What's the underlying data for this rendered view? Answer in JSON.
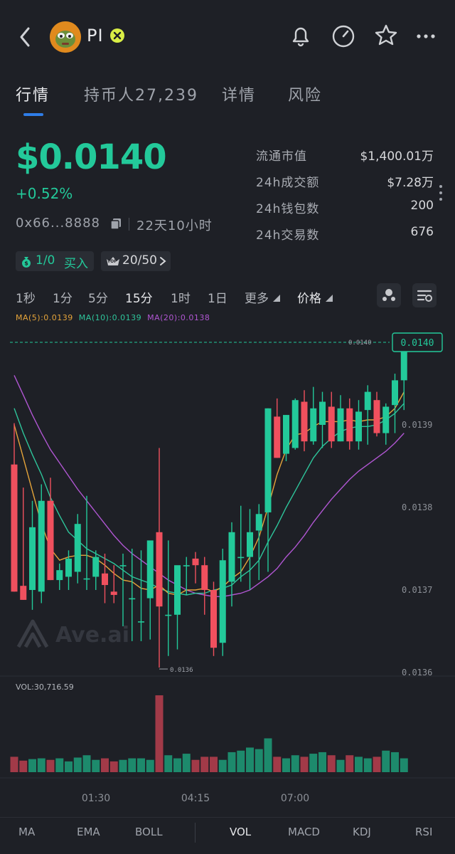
{
  "header": {
    "token_name": "PI",
    "icons": [
      "back-icon",
      "bell-icon",
      "gauge-icon",
      "star-icon",
      "more-icon"
    ]
  },
  "tabs": [
    {
      "label": "行情",
      "active": true
    },
    {
      "label": "持币人27,239",
      "active": false
    },
    {
      "label": "详情",
      "active": false
    },
    {
      "label": "风险",
      "active": false
    }
  ],
  "price": {
    "value": "$0.0140",
    "change": "+0.52%",
    "address": "0x66...8888",
    "duration": "22天10小时"
  },
  "stats": [
    {
      "label": "流通市值",
      "value": "$1,400.01万"
    },
    {
      "label": "24h成交额",
      "value": "$7.28万"
    },
    {
      "label": "24h钱包数",
      "value": "200"
    },
    {
      "label": "24h交易数",
      "value": "676"
    }
  ],
  "pills": {
    "buy_ratio": "1/0",
    "buy_label": "买入",
    "top_badge": "TOP",
    "top_value": "20/50"
  },
  "timeframes": [
    {
      "label": "1秒",
      "active": false
    },
    {
      "label": "1分",
      "active": false
    },
    {
      "label": "5分",
      "active": false
    },
    {
      "label": "15分",
      "active": true
    },
    {
      "label": "1时",
      "active": false
    },
    {
      "label": "1日",
      "active": false
    },
    {
      "label": "更多",
      "active": false
    },
    {
      "label": "价格",
      "active": false
    }
  ],
  "ma_legend": {
    "ma5": "MA(5):0.0139",
    "ma10": "MA(10):0.0139",
    "ma20": "MA(20):0.0138"
  },
  "colors": {
    "up": "#23c99a",
    "down": "#f0505e",
    "ma5": "#e5a43a",
    "ma10": "#2ec59b",
    "ma20": "#b056d2",
    "vol_up": "#1d8a6c",
    "vol_down": "#a23a48"
  },
  "chart_data": {
    "type": "candlestick",
    "interval": "15分",
    "price_ticks": [
      "0.0140",
      "0.0139",
      "0.0138",
      "0.0137",
      "0.0136"
    ],
    "current_price_label": "0.0140",
    "current_price_line_label": "0.0140",
    "low_marker_label": "0.0136",
    "time_labels": [
      "01:30",
      "04:15",
      "07:00"
    ],
    "volume_label": "VOL:30,716.59",
    "watermark": "Ave.ai",
    "candles": [
      {
        "o": 0.013852,
        "h": 0.013902,
        "l": 0.013698,
        "c": 0.013698
      },
      {
        "o": 0.013705,
        "h": 0.013824,
        "l": 0.013688,
        "c": 0.013688
      },
      {
        "o": 0.0137,
        "h": 0.013808,
        "l": 0.013676,
        "c": 0.013776
      },
      {
        "o": 0.013698,
        "h": 0.013828,
        "l": 0.013684,
        "c": 0.013808
      },
      {
        "o": 0.013808,
        "h": 0.013836,
        "l": 0.013712,
        "c": 0.013712
      },
      {
        "o": 0.013712,
        "h": 0.013732,
        "l": 0.0137,
        "c": 0.013724
      },
      {
        "o": 0.013716,
        "h": 0.013748,
        "l": 0.0137,
        "c": 0.013738
      },
      {
        "o": 0.013722,
        "h": 0.013792,
        "l": 0.013708,
        "c": 0.01378
      },
      {
        "o": 0.013714,
        "h": 0.013814,
        "l": 0.0137,
        "c": 0.013714
      },
      {
        "o": 0.013716,
        "h": 0.013748,
        "l": 0.0137,
        "c": 0.01374
      },
      {
        "o": 0.01372,
        "h": 0.013744,
        "l": 0.013684,
        "c": 0.013706
      },
      {
        "o": 0.013698,
        "h": 0.01373,
        "l": 0.013684,
        "c": 0.013694
      },
      {
        "o": 0.01373,
        "h": 0.013744,
        "l": 0.013656,
        "c": 0.01373
      },
      {
        "o": 0.01369,
        "h": 0.01375,
        "l": 0.013638,
        "c": 0.01369
      },
      {
        "o": 0.013662,
        "h": 0.013748,
        "l": 0.013638,
        "c": 0.013662
      },
      {
        "o": 0.01369,
        "h": 0.013752,
        "l": 0.01364,
        "c": 0.01376
      },
      {
        "o": 0.01377,
        "h": 0.013872,
        "l": 0.013606,
        "c": 0.01368
      },
      {
        "o": 0.01367,
        "h": 0.01376,
        "l": 0.01362,
        "c": 0.01367
      },
      {
        "o": 0.01367,
        "h": 0.013726,
        "l": 0.013628,
        "c": 0.01373
      },
      {
        "o": 0.01373,
        "h": 0.01374,
        "l": 0.013694,
        "c": 0.01373
      },
      {
        "o": 0.013738,
        "h": 0.013746,
        "l": 0.013708,
        "c": 0.01373
      },
      {
        "o": 0.01373,
        "h": 0.01374,
        "l": 0.01367,
        "c": 0.0137
      },
      {
        "o": 0.0137,
        "h": 0.01371,
        "l": 0.01362,
        "c": 0.01363
      },
      {
        "o": 0.013636,
        "h": 0.01375,
        "l": 0.01362,
        "c": 0.013736
      },
      {
        "o": 0.01371,
        "h": 0.013782,
        "l": 0.01368,
        "c": 0.01377
      },
      {
        "o": 0.01374,
        "h": 0.013802,
        "l": 0.01371,
        "c": 0.01374
      },
      {
        "o": 0.01374,
        "h": 0.013798,
        "l": 0.0137,
        "c": 0.01377
      },
      {
        "o": 0.013772,
        "h": 0.013804,
        "l": 0.013712,
        "c": 0.013792
      },
      {
        "o": 0.013794,
        "h": 0.01392,
        "l": 0.013722,
        "c": 0.01392
      },
      {
        "o": 0.01391,
        "h": 0.013932,
        "l": 0.01386,
        "c": 0.01386
      },
      {
        "o": 0.013865,
        "h": 0.013912,
        "l": 0.013856,
        "c": 0.013912
      },
      {
        "o": 0.013872,
        "h": 0.013932,
        "l": 0.01387,
        "c": 0.01393
      },
      {
        "o": 0.013928,
        "h": 0.013942,
        "l": 0.013868,
        "c": 0.01388
      },
      {
        "o": 0.01388,
        "h": 0.013946,
        "l": 0.013876,
        "c": 0.01392
      },
      {
        "o": 0.0139,
        "h": 0.01394,
        "l": 0.013872,
        "c": 0.013928
      },
      {
        "o": 0.013922,
        "h": 0.01394,
        "l": 0.013872,
        "c": 0.01388
      },
      {
        "o": 0.01388,
        "h": 0.013936,
        "l": 0.01388,
        "c": 0.01392
      },
      {
        "o": 0.01392,
        "h": 0.013932,
        "l": 0.01387,
        "c": 0.01388
      },
      {
        "o": 0.01388,
        "h": 0.01393,
        "l": 0.01387,
        "c": 0.013916
      },
      {
        "o": 0.013918,
        "h": 0.013948,
        "l": 0.013876,
        "c": 0.01394
      },
      {
        "o": 0.01393,
        "h": 0.01394,
        "l": 0.013886,
        "c": 0.01389
      },
      {
        "o": 0.01389,
        "h": 0.013926,
        "l": 0.013876,
        "c": 0.013922
      },
      {
        "o": 0.013924,
        "h": 0.013962,
        "l": 0.01389,
        "c": 0.013954
      },
      {
        "o": 0.013954,
        "h": 0.014008,
        "l": 0.013918,
        "c": 0.014004
      }
    ],
    "volume": [
      20,
      15,
      17,
      18,
      16,
      18,
      14,
      19,
      22,
      16,
      18,
      14,
      16,
      18,
      18,
      16,
      100,
      22,
      18,
      24,
      16,
      20,
      20,
      16,
      26,
      28,
      32,
      30,
      44,
      20,
      18,
      22,
      20,
      24,
      26,
      22,
      16,
      22,
      20,
      18,
      20,
      28,
      26,
      18
    ],
    "ma5": [
      0.0139,
      0.01386,
      0.01382,
      0.01378,
      0.01375,
      0.013736,
      0.01374,
      0.013742,
      0.013742,
      0.013738,
      0.01373,
      0.01372,
      0.013712,
      0.01371,
      0.013702,
      0.0137,
      0.013706,
      0.013696,
      0.013694,
      0.0137,
      0.0137,
      0.013702,
      0.013698,
      0.013704,
      0.013714,
      0.013722,
      0.01374,
      0.013764,
      0.0138,
      0.01384,
      0.01387,
      0.013888,
      0.01389,
      0.013898,
      0.013904,
      0.013904,
      0.013904,
      0.013906,
      0.013904,
      0.013906,
      0.013906,
      0.01391,
      0.01392,
      0.01394
    ],
    "ma10": [
      0.01392,
      0.01389,
      0.013864,
      0.01384,
      0.013812,
      0.01379,
      0.01377,
      0.01376,
      0.01375,
      0.013744,
      0.013738,
      0.013732,
      0.013724,
      0.013716,
      0.013712,
      0.013708,
      0.013702,
      0.013698,
      0.013696,
      0.013694,
      0.013696,
      0.013696,
      0.0137,
      0.013702,
      0.013706,
      0.013716,
      0.013724,
      0.013736,
      0.013758,
      0.013778,
      0.0138,
      0.01382,
      0.01384,
      0.01386,
      0.013874,
      0.013884,
      0.013892,
      0.013896,
      0.013898,
      0.013898,
      0.0139,
      0.013906,
      0.013914,
      0.013926
    ],
    "ma20": [
      0.01396,
      0.013936,
      0.013912,
      0.01389,
      0.01387,
      0.013854,
      0.013838,
      0.013822,
      0.013808,
      0.013794,
      0.01378,
      0.013766,
      0.013754,
      0.013744,
      0.013736,
      0.013728,
      0.01372,
      0.013712,
      0.013706,
      0.0137,
      0.013696,
      0.013694,
      0.013692,
      0.013692,
      0.013694,
      0.013696,
      0.0137,
      0.013708,
      0.013716,
      0.013726,
      0.01374,
      0.013752,
      0.013766,
      0.013782,
      0.013796,
      0.01381,
      0.013822,
      0.013834,
      0.013844,
      0.013852,
      0.01386,
      0.013868,
      0.013878,
      0.01389
    ]
  },
  "indicators": [
    {
      "label": "MA",
      "active": false
    },
    {
      "label": "EMA",
      "active": false
    },
    {
      "label": "BOLL",
      "active": false
    },
    {
      "label": "VOL",
      "active": true
    },
    {
      "label": "MACD",
      "active": false
    },
    {
      "label": "KDJ",
      "active": false
    },
    {
      "label": "RSI",
      "active": false
    }
  ]
}
